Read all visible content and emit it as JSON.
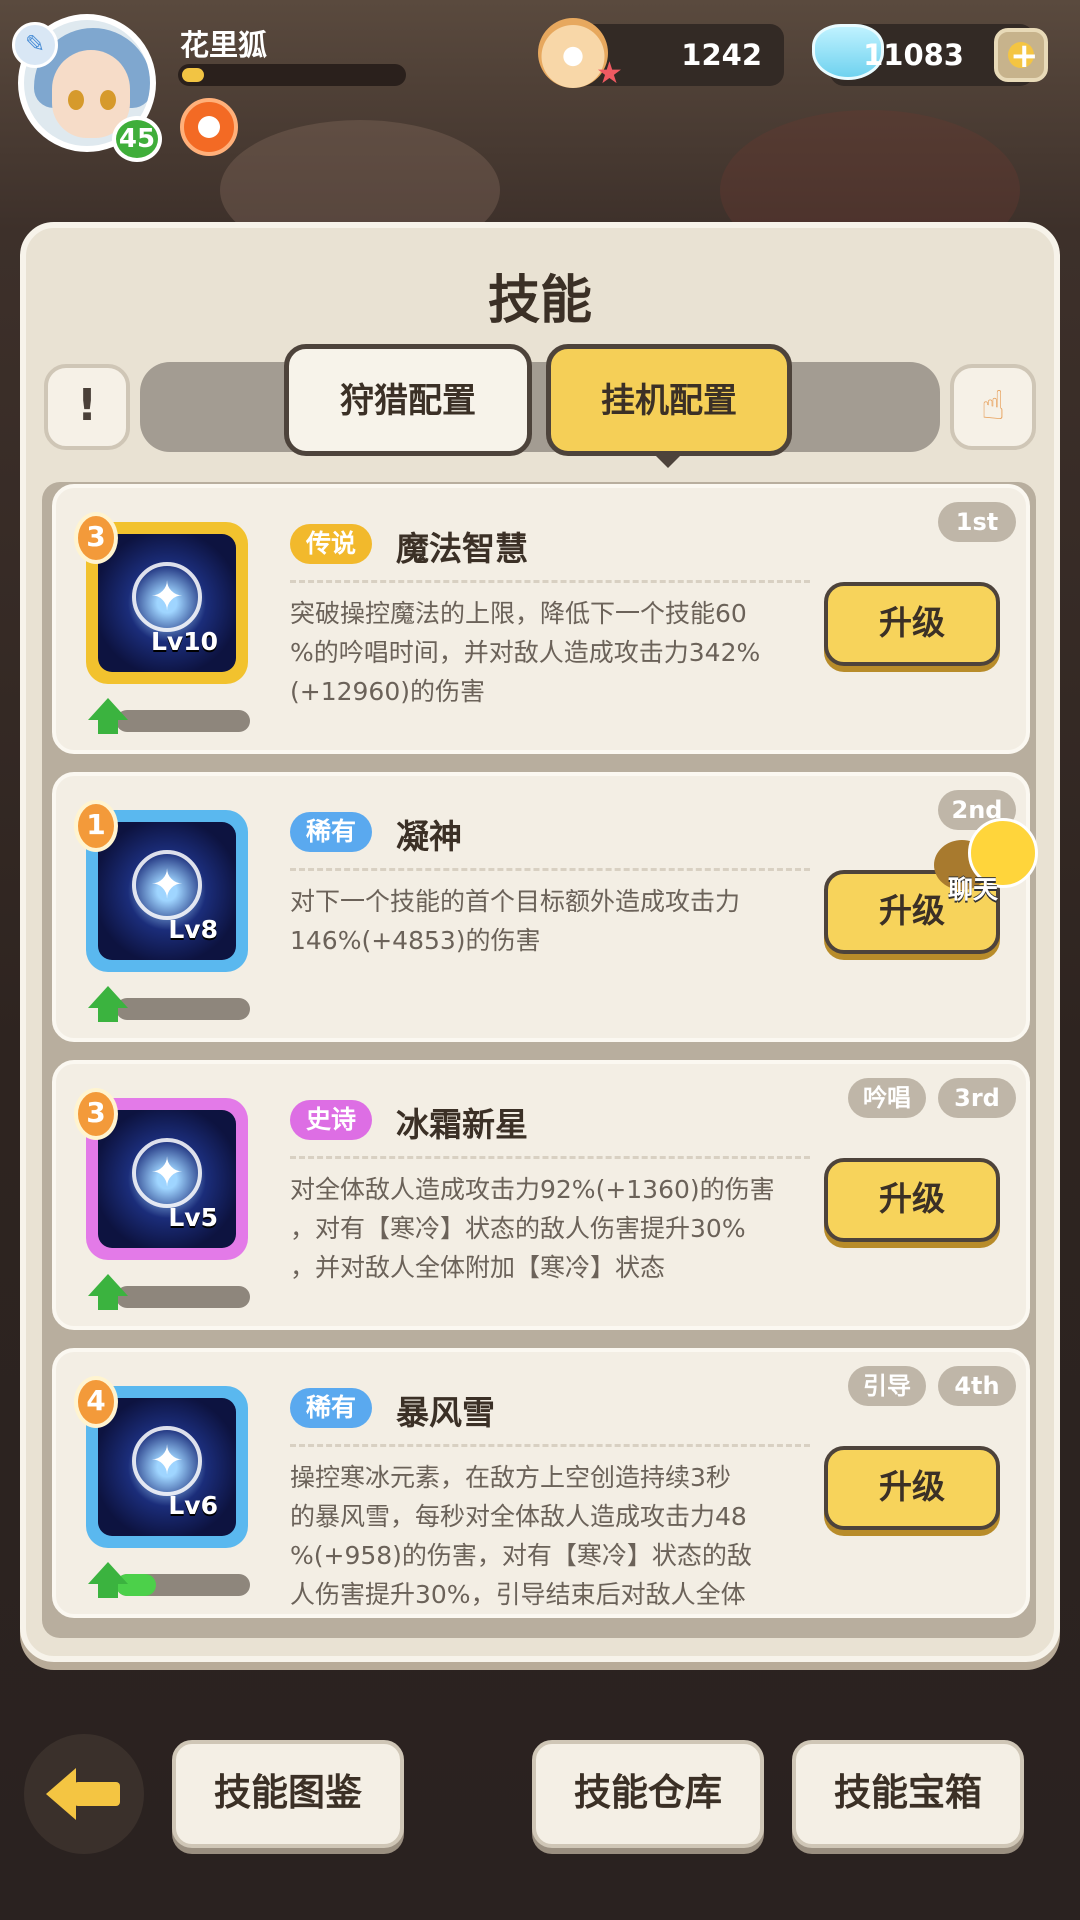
{
  "player": {
    "name": "花里狐",
    "level": "45",
    "exp_progress": 0.1
  },
  "resources": {
    "pearl": "1242",
    "gem": "11083"
  },
  "panel": {
    "title": "技能"
  },
  "tabs": [
    {
      "label": "狩猎配置",
      "active": false
    },
    {
      "label": "挂机配置",
      "active": true
    }
  ],
  "skills": [
    {
      "rank_badge": "3",
      "rarity": "传说",
      "rarity_color": "#f2b92c",
      "frame_color": "#f2c22e",
      "name": "魔法智慧",
      "level": "Lv10",
      "slot": "1st",
      "tags": [],
      "desc": [
        "突破操控魔法的上限，降低下一个技能60",
        "%的吟唱时间，并对敌人造成攻击力342%",
        "(+12960)的伤害"
      ],
      "progress": 0.0,
      "button": "升级"
    },
    {
      "rank_badge": "1",
      "rarity": "稀有",
      "rarity_color": "#5aa9ef",
      "frame_color": "#5ab8ef",
      "name": "凝神",
      "level": "Lv8",
      "slot": "2nd",
      "tags": [],
      "desc": [
        "对下一个技能的首个目标额外造成攻击力",
        "146%(+4853)的伤害"
      ],
      "progress": 0.0,
      "button": "升级"
    },
    {
      "rank_badge": "3",
      "rarity": "史诗",
      "rarity_color": "#dd6ee4",
      "frame_color": "#e37ae8",
      "name": "冰霜新星",
      "level": "Lv5",
      "slot": "3rd",
      "tags": [
        "吟唱"
      ],
      "desc": [
        "对全体敌人造成攻击力92%(+1360)的伤害",
        "，对有【寒冷】状态的敌人伤害提升30%",
        "，并对敌人全体附加【寒冷】状态"
      ],
      "progress": 0.0,
      "button": "升级"
    },
    {
      "rank_badge": "4",
      "rarity": "稀有",
      "rarity_color": "#5aa9ef",
      "frame_color": "#5ab8ef",
      "name": "暴风雪",
      "level": "Lv6",
      "slot": "4th",
      "tags": [
        "引导"
      ],
      "desc": [
        "操控寒冰元素，在敌方上空创造持续3秒",
        "的暴风雪，每秒对全体敌人造成攻击力48",
        "%(+958)的伤害，对有【寒冷】状态的敌",
        "人伤害提升30%，引导结束后对敌人全体"
      ],
      "progress": 0.3,
      "button": "升级"
    }
  ],
  "chat": {
    "label": "聊天"
  },
  "bottom": {
    "codex": "技能图鉴",
    "storage": "技能仓库",
    "chest": "技能宝箱"
  }
}
